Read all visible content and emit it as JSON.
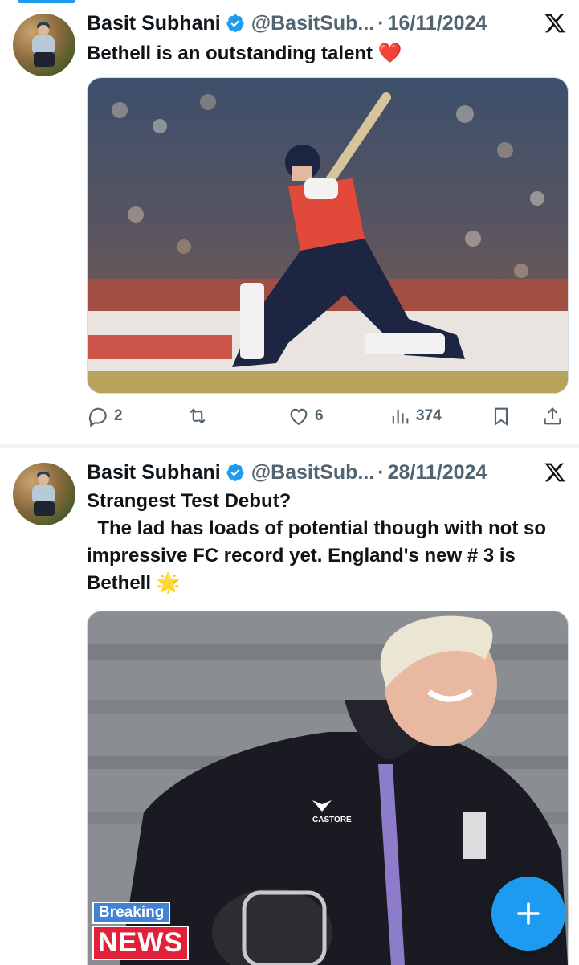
{
  "tweets": [
    {
      "name": "Basit Subhani",
      "handle": "@BasitSub...",
      "separator": "·",
      "date": "16/11/2024",
      "text": "Bethell is an outstanding talent ❤️",
      "image_description": "Cricketer in red England T20 kit playing a lofted shot",
      "actions": {
        "replies": "2",
        "reposts": "",
        "likes": "6",
        "views": "374"
      }
    },
    {
      "name": "Basit Subhani",
      "handle": "@BasitSub...",
      "separator": "·",
      "date": "28/11/2024",
      "text": "Strangest Test Debut?\n  The lad has loads of potential though with not so impressive FC record yet. England's new # 3 is Bethell 🌟",
      "image_description": "Smiling blond cricketer in black England training jacket holding helmet",
      "overlay": {
        "breaking": "Breaking",
        "news": "NEWS"
      },
      "jacket_brand": "CASTORE"
    }
  ],
  "colors": {
    "accent": "#1d9bf0",
    "secondary_text": "#536471",
    "divider": "#eff3f4"
  },
  "icons": [
    "verified-icon",
    "x-logo-icon",
    "reply-icon",
    "repost-icon",
    "like-icon",
    "views-icon",
    "bookmark-icon",
    "share-icon",
    "compose-plus-icon"
  ]
}
